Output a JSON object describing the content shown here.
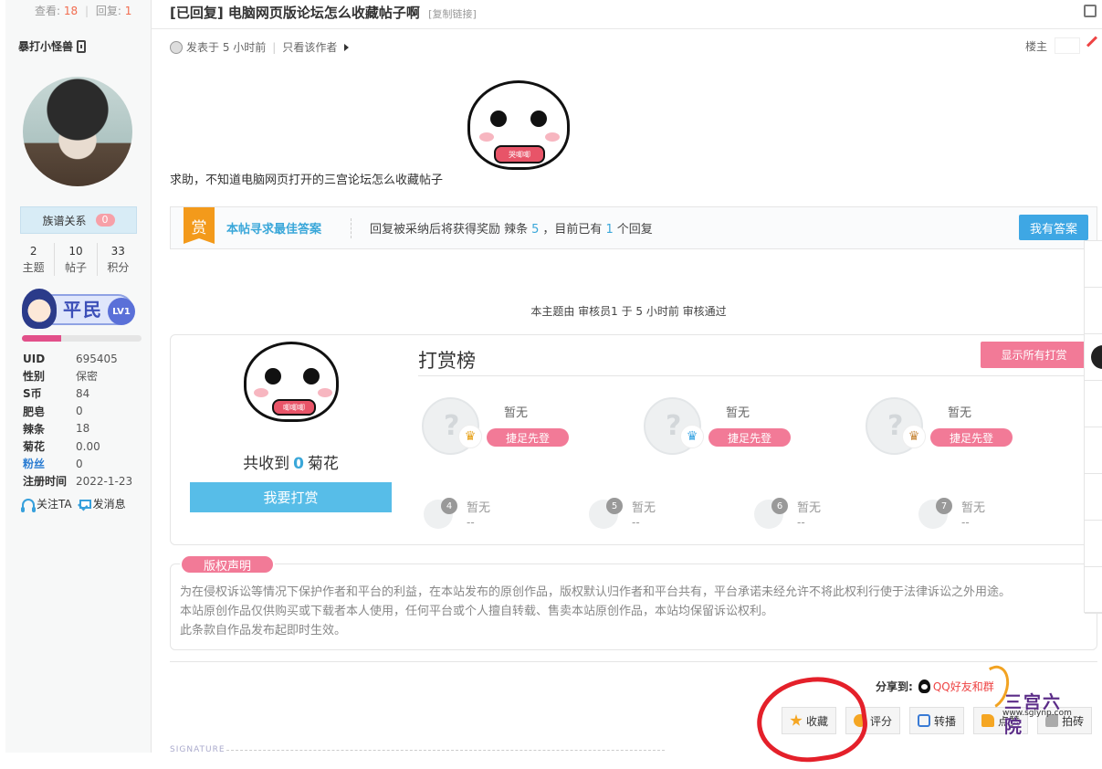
{
  "sidebar": {
    "view_label": "查看:",
    "views": "18",
    "reply_label": "回复:",
    "replies": "1",
    "author": "暴打小怪兽",
    "jiapu_label": "族谱关系",
    "jiapu_count": "0",
    "counts": [
      {
        "value": "2",
        "label": "主题"
      },
      {
        "value": "10",
        "label": "帖子"
      },
      {
        "value": "33",
        "label": "积分"
      }
    ],
    "rank_title": "平民",
    "rank_level": "LV1",
    "rank_progress": 0.33,
    "info": [
      {
        "key": "UID",
        "value": "695405"
      },
      {
        "key": "性别",
        "value": "保密"
      },
      {
        "key": "S币",
        "value": "84"
      },
      {
        "key": "肥皂",
        "value": "0"
      },
      {
        "key": "辣条",
        "value": "18"
      },
      {
        "key": "菊花",
        "value": "0.00"
      },
      {
        "key": "粉丝",
        "value": "0"
      },
      {
        "key": "注册时间",
        "value": "2022-1-23"
      }
    ],
    "follow": "关注TA",
    "message": "发消息"
  },
  "post": {
    "title": "[已回复] 电脑网页版论坛怎么收藏帖子啊",
    "copy_link": "[复制链接]",
    "posted": "发表于 5 小时前",
    "only_author": "只看该作者",
    "floor": "楼主",
    "sticker_text": "哭唧唧",
    "content": "求助，不知道电脑网页打开的三宫论坛怎么收藏帖子"
  },
  "reward": {
    "tag": "赏",
    "heading": "本帖寻求最佳答案",
    "desc_a": "回复被采纳后将获得奖励 辣条",
    "amount": "5",
    "desc_b": "，目前已有",
    "reply_count": "1",
    "desc_c": "个回复",
    "answer_btn": "我有答案"
  },
  "audit": "本主题由 审核员1 于 5 小时前 审核通过",
  "dashang": {
    "sticker_text": "唧唧唧",
    "received_a": "共收到",
    "received_n": "0",
    "received_b": "菊花",
    "give_btn": "我要打赏",
    "board_title": "打赏榜",
    "show_all": "显示所有打赏",
    "top": [
      {
        "name": "暂无",
        "action": "捷足先登",
        "crown": "gold-crown"
      },
      {
        "name": "暂无",
        "action": "捷足先登",
        "crown": "blue-crown"
      },
      {
        "name": "暂无",
        "action": "捷足先登",
        "crown": "bronze-crown"
      }
    ],
    "rest": [
      {
        "rank": "4",
        "name": "暂无",
        "value": "--"
      },
      {
        "rank": "5",
        "name": "暂无",
        "value": "--"
      },
      {
        "rank": "6",
        "name": "暂无",
        "value": "--"
      },
      {
        "rank": "7",
        "name": "暂无",
        "value": "--"
      }
    ]
  },
  "copyright": {
    "tag": "版权声明",
    "lines": [
      "为在侵权诉讼等情况下保护作者和平台的利益，在本站发布的原创作品，版权默认归作者和平台共有，平台承诺未经允许不将此权利行使于法律诉讼之外用途。",
      "本站原创作品仅供购买或下载者本人使用，任何平台或个人擅自转载、售卖本站原创作品，本站均保留诉讼权利。",
      "此条款自作品发布起即时生效。"
    ]
  },
  "share": {
    "label": "分享到:",
    "qq": "QQ好友和群"
  },
  "buttons": [
    {
      "label": "收藏",
      "icon": "star-icon",
      "color": "#f5a623"
    },
    {
      "label": "评分",
      "icon": "rate-icon",
      "color": "#f5a623"
    },
    {
      "label": "转播",
      "icon": "share-icon",
      "color": "#3a7bd5"
    },
    {
      "label": "点赞",
      "icon": "thumb-icon",
      "color": "#f5a623"
    },
    {
      "label": "拍砖",
      "icon": "brick-icon",
      "color": "#999999"
    }
  ],
  "signature": "SIGNATURE",
  "watermark": {
    "title": "三宫六院",
    "url": "www.sglynp.com"
  }
}
